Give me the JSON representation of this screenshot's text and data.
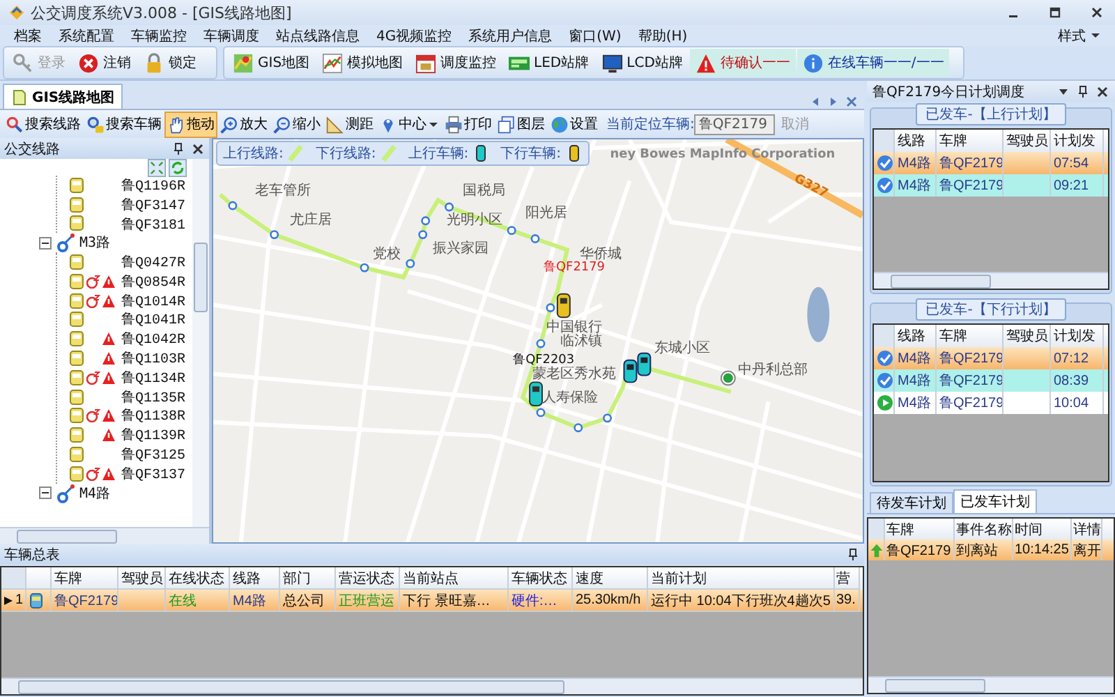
{
  "window": {
    "title": "公交调度系统V3.008 - [GIS线路地图]"
  },
  "menu": [
    "档案",
    "系统配置",
    "车辆监控",
    "车辆调度",
    "站点线路信息",
    "4G视频监控",
    "系统用户信息",
    "窗口(W)",
    "帮助(H)"
  ],
  "menu_right": "样式",
  "toolbar_groups": [
    [
      {
        "label": "登录",
        "kind": "key",
        "disabled": true
      },
      {
        "label": "注销",
        "kind": "logout",
        "disabled": false
      },
      {
        "label": "锁定",
        "kind": "lock",
        "disabled": false
      }
    ],
    [
      {
        "label": "GIS地图",
        "kind": "gis",
        "disabled": false
      },
      {
        "label": "模拟地图",
        "kind": "chart",
        "disabled": false
      },
      {
        "label": "调度监控",
        "kind": "calendar",
        "disabled": false
      },
      {
        "label": "LED站牌",
        "kind": "led",
        "disabled": false
      },
      {
        "label": "LCD站牌",
        "kind": "lcd",
        "disabled": false
      },
      {
        "label": "待确认一一",
        "kind": "warning",
        "disabled": false
      },
      {
        "label": "在线车辆一一/一一",
        "kind": "info",
        "disabled": false
      }
    ]
  ],
  "doc_tab": {
    "label": "GIS线路地图",
    "selected": true
  },
  "map_toolbar": {
    "tools": [
      {
        "label": "搜索线路",
        "kind": "route-search",
        "selected": false
      },
      {
        "label": "搜索车辆",
        "kind": "vehicle-search",
        "selected": false
      },
      {
        "label": "拖动",
        "kind": "hand",
        "selected": true
      },
      {
        "label": "放大",
        "kind": "zoom-in",
        "selected": false
      },
      {
        "label": "缩小",
        "kind": "zoom-out",
        "selected": false
      },
      {
        "label": "测距",
        "kind": "ruler",
        "selected": false
      },
      {
        "label": "中心",
        "kind": "center",
        "selected": false
      },
      {
        "label": "打印",
        "kind": "print",
        "selected": false
      },
      {
        "label": "图层",
        "kind": "layers",
        "selected": false
      },
      {
        "label": "设置",
        "kind": "globe",
        "selected": false
      }
    ],
    "current_vehicle_label": "当前定位车辆:",
    "current_vehicle": "鲁QF2179",
    "cancel": {
      "label": "取消",
      "disabled": true
    }
  },
  "tree_panel": {
    "title": "公交线路",
    "routes": [
      {
        "expanded": true,
        "children": [
          {
            "label": "鲁Q1196R",
            "sleeping": false,
            "alarm": false
          },
          {
            "label": "鲁QF3147",
            "sleeping": false,
            "alarm": false
          },
          {
            "label": "鲁QF3181",
            "sleeping": false,
            "alarm": false
          }
        ]
      },
      {
        "label": "M3路",
        "expanded": true,
        "children": [
          {
            "label": "鲁Q0427R",
            "sleeping": false,
            "alarm": false
          },
          {
            "label": "鲁Q0854R",
            "sleeping": true,
            "alarm": true
          },
          {
            "label": "鲁Q1014R",
            "sleeping": true,
            "alarm": true
          },
          {
            "label": "鲁Q1041R",
            "sleeping": false,
            "alarm": false
          },
          {
            "label": "鲁Q1042R",
            "sleeping": false,
            "alarm": true
          },
          {
            "label": "鲁Q1103R",
            "sleeping": false,
            "alarm": true
          },
          {
            "label": "鲁Q1134R",
            "sleeping": true,
            "alarm": true
          },
          {
            "label": "鲁Q1135R",
            "sleeping": false,
            "alarm": false
          },
          {
            "label": "鲁Q1138R",
            "sleeping": true,
            "alarm": true
          },
          {
            "label": "鲁Q1139R",
            "sleeping": false,
            "alarm": true
          },
          {
            "label": "鲁QF3125",
            "sleeping": false,
            "alarm": false
          },
          {
            "label": "鲁QF3137",
            "sleeping": true,
            "alarm": true
          }
        ]
      },
      {
        "label": "M4路",
        "expanded": true
      }
    ]
  },
  "map": {
    "legend": [
      {
        "label": "上行线路:",
        "kind": "line",
        "color": "#c8f07a"
      },
      {
        "label": "下行线路:",
        "kind": "line",
        "color": "#c8f07a"
      },
      {
        "label": "上行车辆:",
        "kind": "car",
        "color": "#20c8c8"
      },
      {
        "label": "下行车辆:",
        "kind": "car",
        "color": "#e8c020"
      }
    ],
    "attribution": "ney Bowes MapInfo Corporation",
    "road_label": "G327",
    "places": [
      "老车管所",
      "尤庄居",
      "党校",
      "国税局",
      "光明小区",
      "阳光居",
      "振兴家园",
      "华侨城",
      "中国银行",
      "临沭镇",
      "蒙老区秀水苑",
      "人寿保险",
      "东城小区",
      "中丹利总部"
    ],
    "vehicles": [
      {
        "label": "鲁QF2179",
        "kind": "down",
        "selected": true
      },
      {
        "label": "鲁QF2203",
        "kind": "up",
        "selected": false
      }
    ]
  },
  "vehicle_table": {
    "title": "车辆总表",
    "columns": [
      "车牌",
      "驾驶员",
      "在线状态",
      "线路",
      "部门",
      "营运状态",
      "当前站点",
      "车辆状态",
      "速度",
      "当前计划",
      "营"
    ],
    "rows": [
      {
        "index": "1",
        "selected": true,
        "cells": [
          {
            "text": "鲁QF2179"
          },
          {},
          {
            "text": "在线",
            "kind": "ok"
          },
          {
            "text": "M4路"
          },
          {
            "text": "总公司"
          },
          {
            "text": "正班营运",
            "kind": "ok"
          },
          {
            "text": "下行  景旺嘉…"
          },
          {
            "text": "硬件:…",
            "kind": "info"
          },
          {
            "text": "25.30km/h"
          },
          {
            "text": "运行中 10:04下行班次4趟次5"
          },
          {
            "text": "39."
          }
        ]
      }
    ]
  },
  "right_panel": {
    "title": "鲁QF2179今日计划调度",
    "plan_groups": [
      {
        "title": "已发车-【上行计划】",
        "columns": [
          "线路",
          "车牌",
          "驾驶员",
          "计划发"
        ],
        "rows": [
          {
            "kind": "departed",
            "selected": true,
            "line": "M4路",
            "plate": "鲁QF2179",
            "time": "07:54"
          },
          {
            "kind": "departed",
            "selected": false,
            "line": "M4路",
            "plate": "鲁QF2179",
            "time": "09:21"
          }
        ]
      },
      {
        "title": "已发车-【下行计划】",
        "columns": [
          "线路",
          "车牌",
          "驾驶员",
          "计划发"
        ],
        "rows": [
          {
            "kind": "departed",
            "selected": true,
            "line": "M4路",
            "plate": "鲁QF2179",
            "time": "07:12"
          },
          {
            "kind": "departed",
            "selected": false,
            "line": "M4路",
            "plate": "鲁QF2179",
            "time": "08:39"
          },
          {
            "kind": "running",
            "selected": false,
            "line": "M4路",
            "plate": "鲁QF2179",
            "time": "10:04"
          }
        ]
      }
    ],
    "tabs": [
      {
        "label": "待发车计划",
        "selected": false
      },
      {
        "label": "已发车计划",
        "selected": true
      }
    ],
    "events": {
      "columns": [
        "车牌",
        "事件名称",
        "时间",
        "详情"
      ],
      "rows": [
        {
          "plate": "鲁QF2179",
          "event": "到离站",
          "time": "10:14:25",
          "detail": "离开",
          "selected": true
        }
      ]
    }
  }
}
